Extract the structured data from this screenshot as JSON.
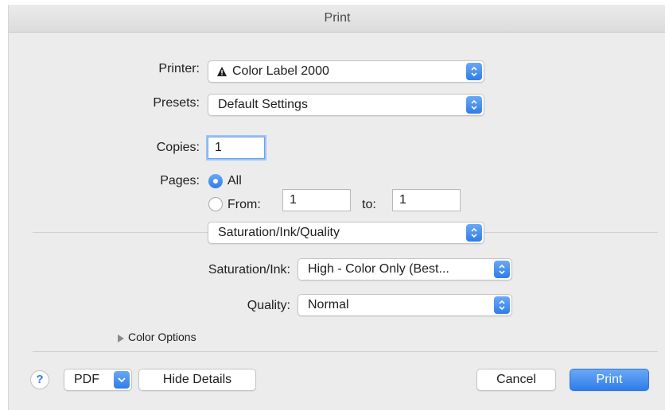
{
  "window": {
    "title": "Print"
  },
  "printer": {
    "label": "Printer:",
    "warning_icon": "warning-triangle-icon",
    "value": "Color Label 2000"
  },
  "presets": {
    "label": "Presets:",
    "value": "Default Settings"
  },
  "copies": {
    "label": "Copies:",
    "value": "1"
  },
  "pages": {
    "label": "Pages:",
    "all_label": "All",
    "from_label": "From:",
    "from_value": "1",
    "to_label": "to:",
    "to_value": "1",
    "selected": "All"
  },
  "section_menu": {
    "value": "Saturation/Ink/Quality"
  },
  "saturation": {
    "label": "Saturation/Ink:",
    "value": "High - Color Only (Best..."
  },
  "quality": {
    "label": "Quality:",
    "value": "Normal"
  },
  "color_options": {
    "label": "Color Options"
  },
  "footer": {
    "help_label": "?",
    "pdf_label": "PDF",
    "hide_details_label": "Hide Details",
    "cancel_label": "Cancel",
    "print_label": "Print"
  },
  "colors": {
    "accent": "#2f7de8",
    "background": "#ececec"
  }
}
